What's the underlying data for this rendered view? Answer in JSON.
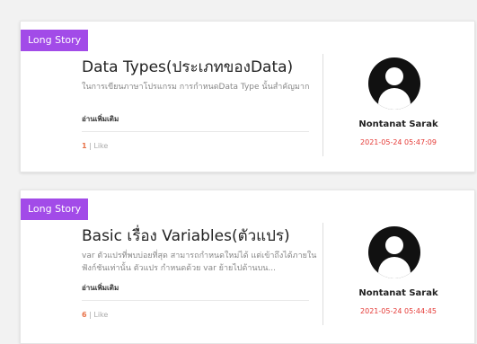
{
  "posts": [
    {
      "badge": "Long Story",
      "title": "Data Types(ประเภทของData)",
      "excerpt": "ในการเขียนภาษาโปรแกรม การกำหนดData Type นั้นสำคัญมาก",
      "read_more": "อ่านเพิ่มเติม",
      "likes_count": "1",
      "likes_label": "| Like",
      "author": "Nontanat Sarak",
      "date": "2021-05-24 05:47:09"
    },
    {
      "badge": "Long Story",
      "title": "Basic เรื่อง Variables(ตัวแปร)",
      "excerpt": "var ตัวแปรที่พบบ่อยที่สุด สามารถกำหนดใหม่ได้ แต่เข้าถึงได้ภายในฟังก์ชันเท่านั้น ตัวแปร กำหนดด้วย var ย้ายไปด้านบน...",
      "read_more": "อ่านเพิ่มเติม",
      "likes_count": "6",
      "likes_label": "| Like",
      "author": "Nontanat Sarak",
      "date": "2021-05-24 05:44:45"
    }
  ],
  "colors": {
    "badge": "#a24be8",
    "date": "#e53935",
    "like_count": "#e8734a"
  }
}
